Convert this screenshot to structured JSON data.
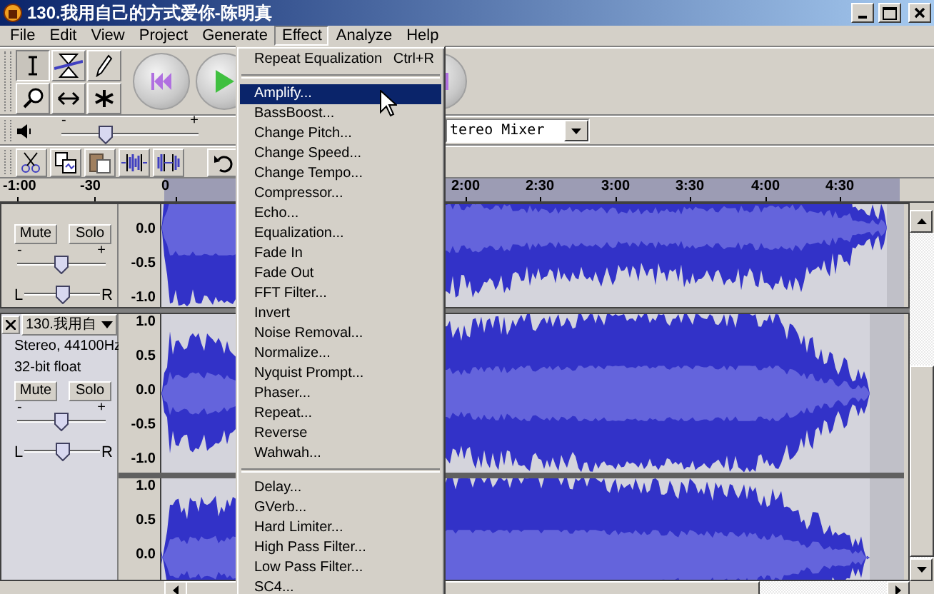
{
  "window": {
    "title": "130.我用自己的方式爱你-陈明真"
  },
  "menu_bar": [
    {
      "label": "File",
      "selected": false
    },
    {
      "label": "Edit",
      "selected": false
    },
    {
      "label": "View",
      "selected": false
    },
    {
      "label": "Project",
      "selected": false
    },
    {
      "label": "Generate",
      "selected": false
    },
    {
      "label": "Effect",
      "selected": true
    },
    {
      "label": "Analyze",
      "selected": false
    },
    {
      "label": "Help",
      "selected": false
    }
  ],
  "tools": [
    {
      "selected": true
    },
    {
      "selected": false
    },
    {
      "selected": false
    },
    {
      "selected": false
    },
    {
      "selected": false
    },
    {
      "selected": false
    }
  ],
  "volume": {
    "min": "-",
    "max": "+",
    "level": 0.32
  },
  "device_select": {
    "value": "tereo Mixer"
  },
  "ruler": {
    "labels": [
      "-1:00",
      "-30",
      "0",
      "2:00",
      "2:30",
      "3:00",
      "3:30",
      "4:00",
      "4:30"
    ]
  },
  "tracks": [
    {
      "mute": "Mute",
      "solo": "Solo",
      "gain": {
        "min": "-",
        "max": "+",
        "level": 0.5
      },
      "pan": {
        "left": "L",
        "right": "R",
        "level": 0.5
      },
      "channels": [
        {
          "axis": [
            "0.0",
            "-0.5",
            "-1.0"
          ]
        }
      ]
    },
    {
      "name": "130.我用自",
      "info": [
        "Stereo, 44100Hz",
        "32-bit float"
      ],
      "mute": "Mute",
      "solo": "Solo",
      "gain": {
        "min": "-",
        "max": "+",
        "level": 0.5
      },
      "pan": {
        "left": "L",
        "right": "R",
        "level": 0.5
      },
      "channels": [
        {
          "axis": [
            "1.0",
            "0.5",
            "0.0",
            "-0.5",
            "-1.0"
          ]
        },
        {
          "axis": [
            "1.0",
            "0.5",
            "0.0"
          ]
        }
      ]
    }
  ],
  "effect_menu": {
    "items": [
      {
        "kind": "item",
        "label": "Repeat Equalization",
        "shortcut": "Ctrl+R",
        "selected": false
      },
      {
        "kind": "separator"
      },
      {
        "kind": "item",
        "label": "Amplify...",
        "selected": true
      },
      {
        "kind": "item",
        "label": "BassBoost...",
        "selected": false
      },
      {
        "kind": "item",
        "label": "Change Pitch...",
        "selected": false
      },
      {
        "kind": "item",
        "label": "Change Speed...",
        "selected": false
      },
      {
        "kind": "item",
        "label": "Change Tempo...",
        "selected": false
      },
      {
        "kind": "item",
        "label": "Compressor...",
        "selected": false
      },
      {
        "kind": "item",
        "label": "Echo...",
        "selected": false
      },
      {
        "kind": "item",
        "label": "Equalization...",
        "selected": false
      },
      {
        "kind": "item",
        "label": "Fade In",
        "selected": false
      },
      {
        "kind": "item",
        "label": "Fade Out",
        "selected": false
      },
      {
        "kind": "item",
        "label": "FFT Filter...",
        "selected": false
      },
      {
        "kind": "item",
        "label": "Invert",
        "selected": false
      },
      {
        "kind": "item",
        "label": "Noise Removal...",
        "selected": false
      },
      {
        "kind": "item",
        "label": "Normalize...",
        "selected": false
      },
      {
        "kind": "item",
        "label": "Nyquist Prompt...",
        "selected": false
      },
      {
        "kind": "item",
        "label": "Phaser...",
        "selected": false
      },
      {
        "kind": "item",
        "label": "Repeat...",
        "selected": false
      },
      {
        "kind": "item",
        "label": "Reverse",
        "selected": false
      },
      {
        "kind": "item",
        "label": "Wahwah...",
        "selected": false
      },
      {
        "kind": "separator"
      },
      {
        "kind": "item",
        "label": "Delay...",
        "selected": false
      },
      {
        "kind": "item",
        "label": "GVerb...",
        "selected": false
      },
      {
        "kind": "item",
        "label": "Hard Limiter...",
        "selected": false
      },
      {
        "kind": "item",
        "label": "High Pass Filter...",
        "selected": false
      },
      {
        "kind": "item",
        "label": "Low Pass Filter...",
        "selected": false
      },
      {
        "kind": "item",
        "label": "SC4...",
        "selected": false
      }
    ]
  }
}
